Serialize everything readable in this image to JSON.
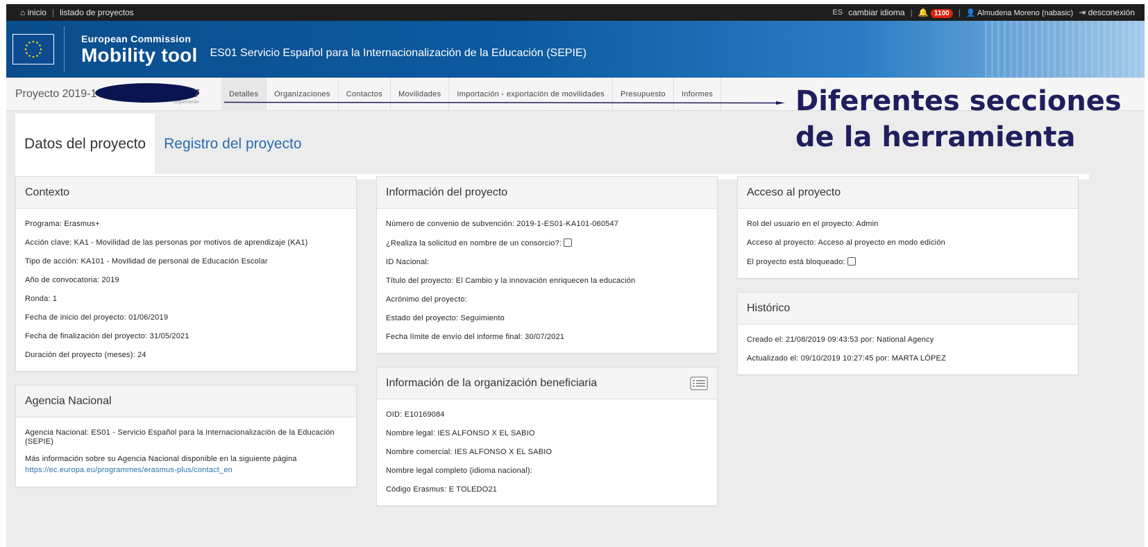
{
  "topbar": {
    "home": "inicio",
    "projects": "listado de proyectos",
    "lang": "ES",
    "change_lang": "cambiar idioma",
    "notifications": "1100",
    "user": "Almudena Moreno (nabasic)",
    "logout": "desconexión",
    "sep": "|"
  },
  "banner": {
    "ec": "European Commission",
    "mt": "Mobility tool",
    "org": "ES01 Servicio Español para la Internacionalización de la Educación (SEPIE)"
  },
  "project": {
    "prefix": "Proyecto 2019-1-E",
    "suffix": "7",
    "status_small": "seguimiento"
  },
  "tabs": [
    "Detalles",
    "Organizaciones",
    "Contactos",
    "Movilidades",
    "Importación - exportación de movilidades",
    "Presupuesto",
    "Informes"
  ],
  "annotation": {
    "line1": "Diferentes secciones",
    "line2": "de la herramienta"
  },
  "subtabs": {
    "active": "Datos del proyecto",
    "other": "Registro del proyecto"
  },
  "contexto": {
    "title": "Contexto",
    "rows": [
      "Programa: Erasmus+",
      "Acción clave: KA1 - Movilidad de las personas por motivos de aprendizaje (KA1)",
      "Tipo de acción: KA101 - Movilidad de personal de Educación Escolar",
      "Año de convocatoria: 2019",
      "Ronda: 1",
      "Fecha de inicio del proyecto: 01/06/2019",
      "Fecha de finalización del proyecto: 31/05/2021",
      "Duración del proyecto (meses): 24"
    ]
  },
  "agencia": {
    "title": "Agencia Nacional",
    "row1": "Agencia Nacional: ES01 - Servicio Español para la Internacionalización de la Educación (SEPIE)",
    "row2": "Más información sobre su Agencia Nacional disponible en la siguiente página",
    "link": "https://ec.europa.eu/programmes/erasmus-plus/contact_en"
  },
  "info_proyecto": {
    "title": "Información del proyecto",
    "convenio": "Número de convenio de subvención: 2019-1-ES01-KA101-060547",
    "consorcio": "¿Realiza la solicitud en nombre de un consorcio?:",
    "id_nacional": "ID Nacional:",
    "titulo": "Título del proyecto: El Cambio y la innovación enriquecen la educación",
    "acronimo": "Acrónimo del proyecto:",
    "estado": "Estado del proyecto: Seguimiento",
    "fecha_limite": "Fecha límite de envío del informe final: 30/07/2021"
  },
  "info_org": {
    "title": "Información de la organización beneficiaria",
    "rows": [
      "OID: E10169084",
      "Nombre legal: IES ALFONSO X EL SABIO",
      "Nombre comercial: IES ALFONSO X EL SABIO",
      "Nombre legal completo (idioma nacional):",
      "Código Erasmus: E TOLEDO21"
    ]
  },
  "acceso": {
    "title": "Acceso al proyecto",
    "rol": "Rol del usuario en el proyecto: Admin",
    "acceso": "Acceso al proyecto: Acceso al proyecto en modo edición",
    "bloqueado": "El proyecto está bloqueado:"
  },
  "historico": {
    "title": "Histórico",
    "creado": "Creado el: 21/08/2019 09:43:53 por: National Agency",
    "actualizado": "Actualizado el: 09/10/2019 10:27:45 por: MARTA LÓPEZ"
  },
  "colors": {
    "topbar": "#1e1e1e",
    "banner": "#0d5aa0",
    "link": "#2b6cb0",
    "annotation": "#1f1f5e",
    "badge": "#d9230f"
  }
}
